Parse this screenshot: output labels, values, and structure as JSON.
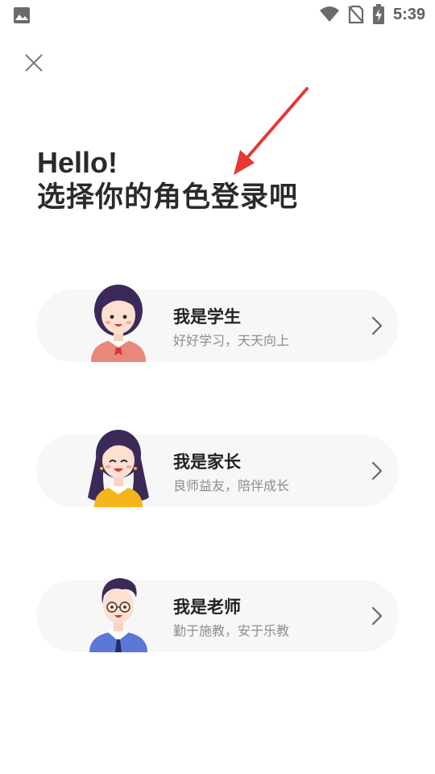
{
  "status_bar": {
    "time": "5:39",
    "icons": [
      "gallery-icon",
      "wifi-icon",
      "no-sim-icon",
      "battery-charging-icon"
    ]
  },
  "header": {
    "close_icon": "close-icon",
    "hello": "Hello!",
    "prompt": "选择你的角色登录吧"
  },
  "annotation": {
    "type": "arrow",
    "color": "#e53935"
  },
  "roles": [
    {
      "id": "student",
      "title": "我是学生",
      "desc": "好好学习，天天向上",
      "avatar_icon": "student-avatar",
      "chevron_icon": "chevron-right-icon"
    },
    {
      "id": "parent",
      "title": "我是家长",
      "desc": "良师益友，陪伴成长",
      "avatar_icon": "parent-avatar",
      "chevron_icon": "chevron-right-icon"
    },
    {
      "id": "teacher",
      "title": "我是老师",
      "desc": "勤于施教，安于乐教",
      "avatar_icon": "teacher-avatar",
      "chevron_icon": "chevron-right-icon"
    }
  ],
  "colors": {
    "card_bg": "#f7f7f7",
    "title": "#2a2a2a",
    "subtitle": "#8c8c8c",
    "arrow": "#e53935"
  }
}
